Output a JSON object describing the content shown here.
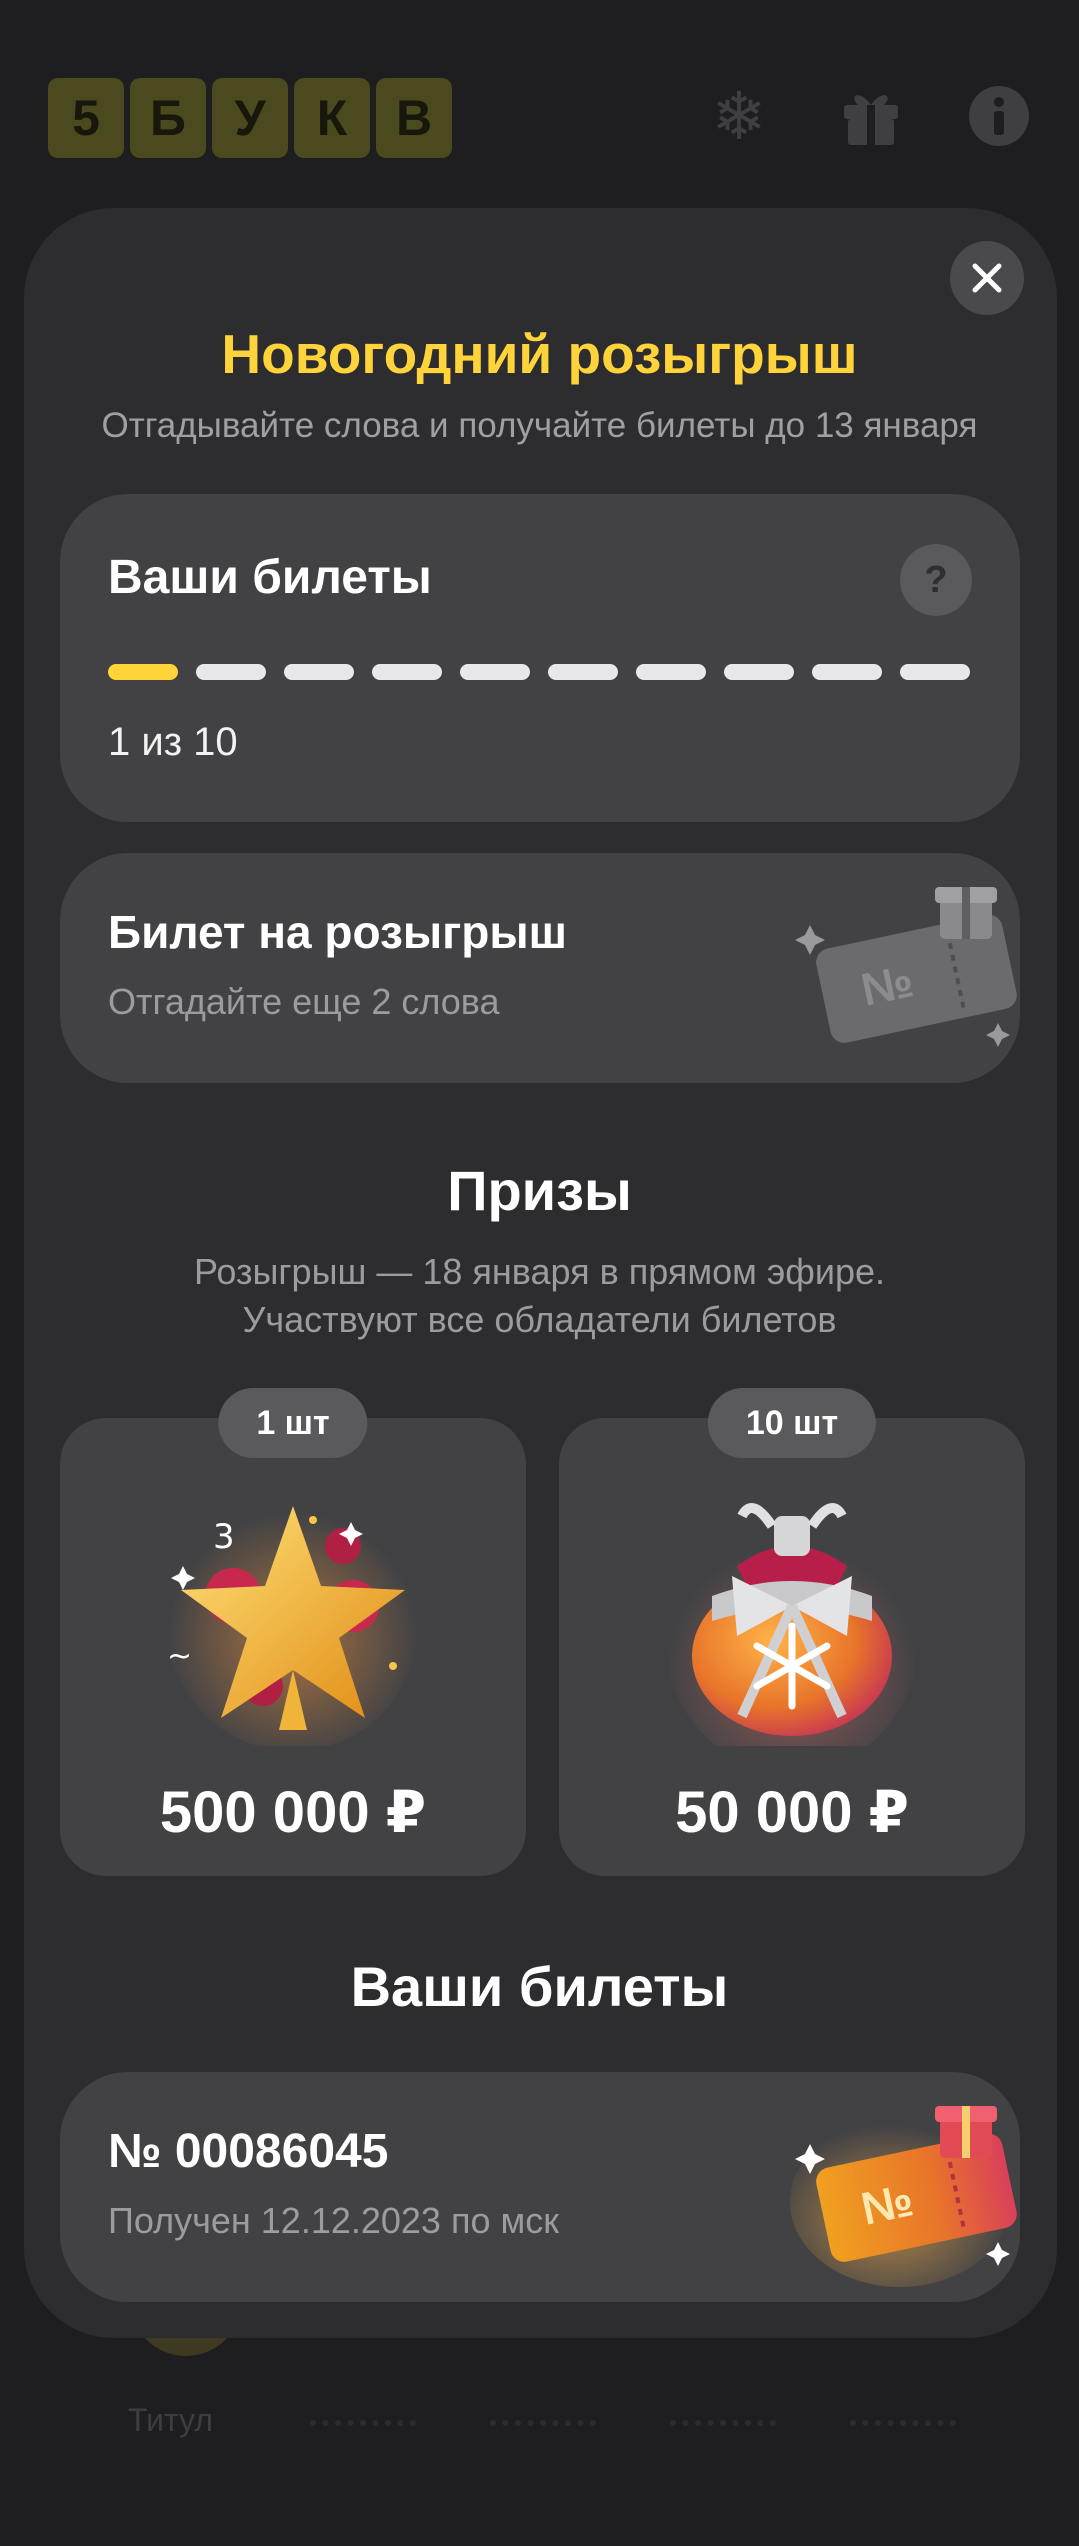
{
  "app": {
    "logo_letters": [
      "5",
      "Б",
      "У",
      "К",
      "В"
    ],
    "bottom_nav_label": "Титул"
  },
  "modal": {
    "title": "Новогодний розыгрыш",
    "subtitle": "Отгадывайте слова и получайте билеты до 13 января",
    "progress_card": {
      "title": "Ваши билеты",
      "help_label": "?",
      "filled": 1,
      "total": 10,
      "text": "1 из 10"
    },
    "next_ticket_card": {
      "title": "Билет на розыгрыш",
      "subtitle": "Отгадайте еще 2 слова",
      "ticket_glyph": "№"
    },
    "prizes_section": {
      "title": "Призы",
      "subtitle_line1": "Розыгрыш — 18 января в прямом эфире.",
      "subtitle_line2": "Участвуют все обладатели билетов",
      "items": [
        {
          "qty": "1 шт",
          "value": "500 000 ₽",
          "icon": "golden-star-icon"
        },
        {
          "qty": "10 шт",
          "value": "50 000 ₽",
          "icon": "gift-bag-icon"
        }
      ]
    },
    "my_tickets_section": {
      "title": "Ваши билеты",
      "tickets": [
        {
          "number": "№ 00086045",
          "received": "Получен 12.12.2023 по мск",
          "ticket_glyph": "№"
        }
      ]
    }
  },
  "colors": {
    "accent_yellow": "#ffd43a",
    "modal_bg": "#2d2d30",
    "card_bg": "#424245",
    "page_bg": "#1e1e20"
  }
}
